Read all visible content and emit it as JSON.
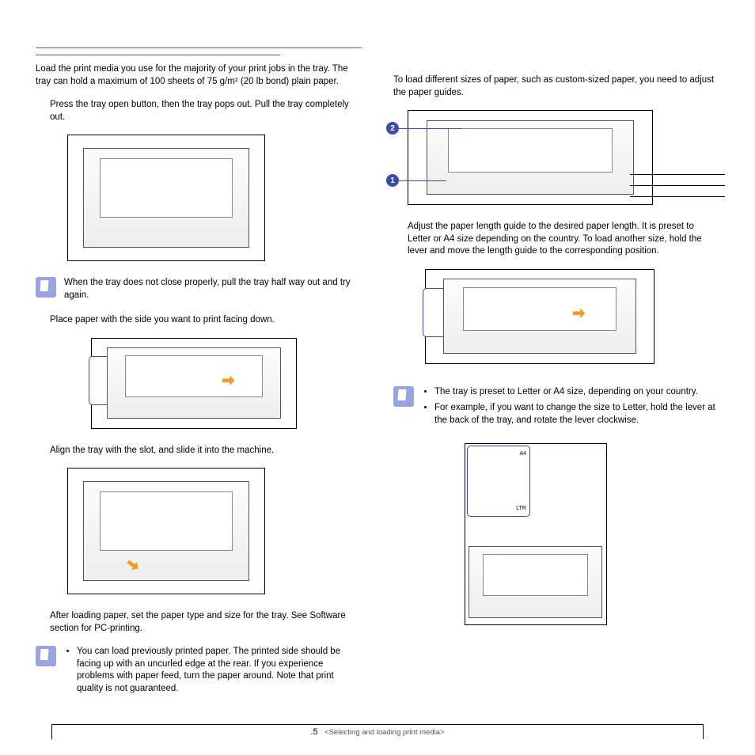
{
  "left": {
    "intro": "Load the print media you use for the majority of your print jobs in the tray. The tray can hold a maximum of 100 sheets of 75 g/m² (20 lb bond) plain paper.",
    "step1": "Press the tray open button, then the tray pops out. Pull the tray completely out.",
    "note1": "When the tray does not close properly, pull the tray half way out and try again.",
    "step2": "Place paper with the side you want to print facing down.",
    "step3": "Align the tray with the slot, and slide it into the machine.",
    "step4": "After loading paper, set the paper type and size for the tray. See Software section for PC-printing.",
    "note2_bullets": [
      "You can load previously printed paper. The printed side should be facing up with an uncurled edge at the rear. If you experience problems with paper feed, turn the paper around. Note that print quality is not guaranteed."
    ]
  },
  "right": {
    "intro": "To load different sizes of paper, such as custom-sized paper, you need to adjust the paper guides.",
    "callout_1": "1",
    "callout_2": "2",
    "step1": "Adjust the paper length guide to the desired paper length. It is preset to Letter or A4 size depending on the country. To load another size, hold the lever and move the length guide to the corresponding position.",
    "note_bullets": [
      "The tray is preset to Letter or A4 size, depending on your country.",
      "For example, if you want to change the size to Letter, hold the lever at the back of the tray, and rotate the lever clockwise."
    ],
    "label_a4": "A4",
    "label_ltr": "LTR"
  },
  "footer": {
    "page": ".5",
    "chapter": "<Selecting and loading print media>"
  }
}
